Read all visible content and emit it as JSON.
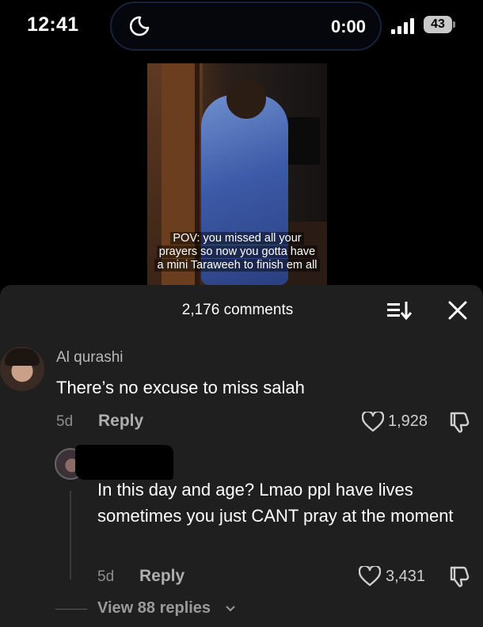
{
  "status_bar": {
    "time": "12:41",
    "island_timer": "0:00",
    "battery": "43",
    "icons": [
      "moon-icon",
      "signal-icon",
      "battery-icon"
    ]
  },
  "video": {
    "caption_lines": [
      "POV: you missed all your",
      "prayers so now you gotta have",
      "a mini Taraweeh to finish em all"
    ]
  },
  "comments_panel": {
    "count_label": "2,176 comments",
    "icons": [
      "sort-icon",
      "close-icon"
    ]
  },
  "comments": [
    {
      "username": "Al qurashi",
      "text": "There’s no excuse to miss salah",
      "age": "5d",
      "reply_label": "Reply",
      "likes": "1,928"
    },
    {
      "text": "In this day and age? Lmao ppl have lives sometimes you just CANT pray at the moment",
      "age": "5d",
      "reply_label": "Reply",
      "likes": "3,431"
    }
  ],
  "view_replies_label": "View 88 replies",
  "colors": {
    "sheet_bg": "#1f1f1f",
    "status_bg": "#000000",
    "muted_text": "#8d8d8d"
  }
}
